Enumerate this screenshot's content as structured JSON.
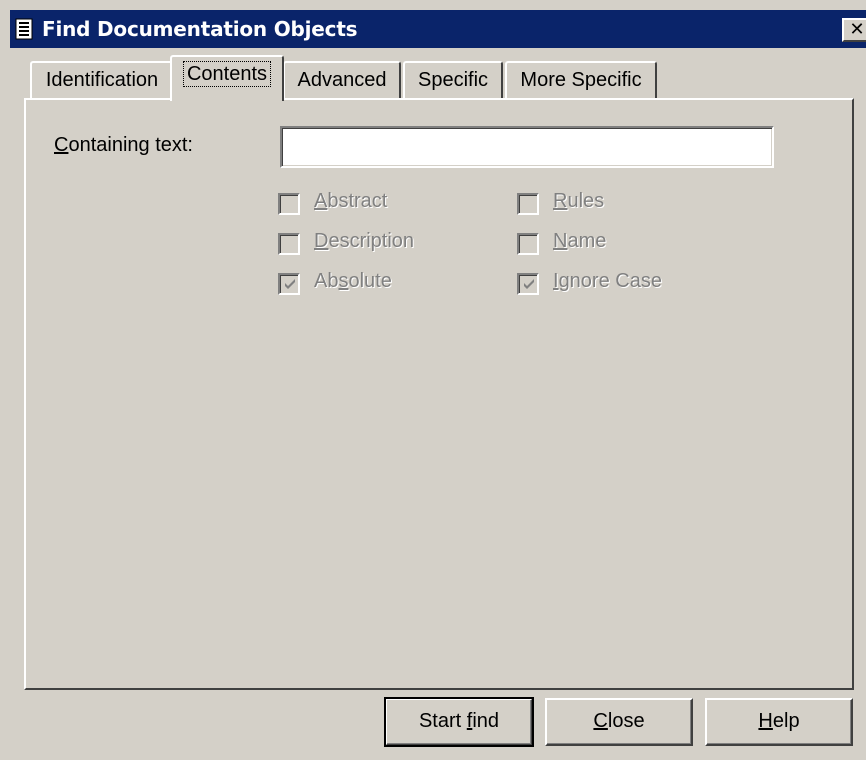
{
  "window": {
    "title": "Find Documentation Objects",
    "close_glyph": "✕",
    "title_color": "#0a246a",
    "title_icon": "document-icon"
  },
  "tabs": [
    {
      "label": "Identification",
      "active": false
    },
    {
      "label": "Contents",
      "active": true
    },
    {
      "label": "Advanced",
      "active": false
    },
    {
      "label": "Specific",
      "active": false
    },
    {
      "label": "More Specific",
      "active": false
    }
  ],
  "contents": {
    "containing_text": {
      "label_mnemonic": "C",
      "label_rest": "ontaining text:",
      "value": ""
    },
    "checkboxes_left": [
      {
        "mnemonic": "A",
        "rest": "bstract",
        "checked": false,
        "enabled": false
      },
      {
        "mnemonic": "D",
        "rest": "escription",
        "checked": false,
        "enabled": false
      },
      {
        "pre": "Ab",
        "mnemonic": "s",
        "rest": "olute",
        "checked": true,
        "enabled": false
      }
    ],
    "checkboxes_right": [
      {
        "mnemonic": "R",
        "rest": "ules",
        "checked": false,
        "enabled": false
      },
      {
        "mnemonic": "N",
        "rest": "ame",
        "checked": false,
        "enabled": false
      },
      {
        "mnemonic": "I",
        "rest": "gnore Case",
        "checked": true,
        "enabled": false
      }
    ]
  },
  "buttons": {
    "start_find": {
      "pre": "Start ",
      "mnemonic": "f",
      "rest": "ind"
    },
    "close": {
      "mnemonic": "C",
      "rest": "lose"
    },
    "help": {
      "mnemonic": "H",
      "rest": "elp"
    }
  }
}
